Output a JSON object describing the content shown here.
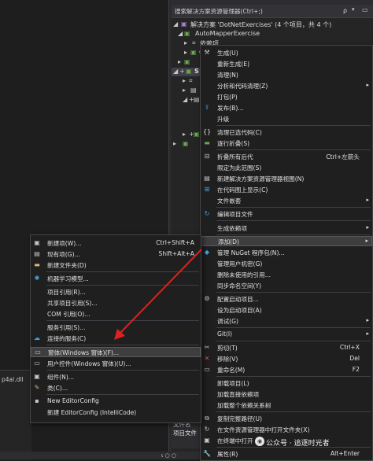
{
  "solution_explorer": {
    "search_placeholder": "搜索解决方案资源管理器(Ctrl+;)",
    "search_icon": "ρ",
    "tree": [
      {
        "text": "解决方案 'DotNetExercises' (4 个项目，共 4 个)"
      },
      {
        "text": "AutoMapperExercise"
      },
      {
        "text": "依赖项"
      },
      {
        "text": "C"
      },
      {
        "text": "S"
      }
    ]
  },
  "output": {
    "line": "p4al.dll"
  },
  "properties": {
    "file_name": "文件名",
    "project_file": "项目文件"
  },
  "status": {
    "zoom": "ι ○ ○"
  },
  "main_menu": {
    "items": [
      {
        "label": "生成(U)",
        "shortcut": "",
        "icon": "build-icon"
      },
      {
        "label": "重新生成(E)",
        "shortcut": ""
      },
      {
        "label": "清理(N)",
        "shortcut": ""
      },
      {
        "label": "分析和代码清理(Z)",
        "shortcut": "",
        "submenu": true
      },
      {
        "label": "打包(P)",
        "shortcut": ""
      },
      {
        "label": "发布(B)...",
        "shortcut": "",
        "icon": "publish-icon"
      },
      {
        "label": "升级",
        "shortcut": ""
      },
      {
        "label": "清理已选代码(C)",
        "shortcut": "",
        "icon": "braces-icon"
      },
      {
        "label": "逐行折叠(S)",
        "shortcut": ""
      },
      {
        "label": "折叠所有后代",
        "shortcut": "Ctrl+左箭头"
      },
      {
        "label": "限定为此范围(S)",
        "shortcut": ""
      },
      {
        "label": "新建解决方案资源管理器视图(N)",
        "shortcut": ""
      },
      {
        "label": "在代码图上显示(C)",
        "shortcut": ""
      },
      {
        "label": "文件嵌套",
        "shortcut": "",
        "submenu": true
      },
      {
        "label": "编辑项目文件",
        "shortcut": ""
      },
      {
        "label": "生成依赖项",
        "shortcut": "",
        "submenu": true
      },
      {
        "label": "添加(D)",
        "shortcut": "",
        "submenu": true
      },
      {
        "label": "管理 NuGet 程序包(N)...",
        "shortcut": ""
      },
      {
        "label": "管理用户机密(G)",
        "shortcut": ""
      },
      {
        "label": "删除未使用的引用...",
        "shortcut": ""
      },
      {
        "label": "同步命名空间(Y)",
        "shortcut": ""
      },
      {
        "label": "配置启动项目...",
        "shortcut": ""
      },
      {
        "label": "设为启动项目(A)",
        "shortcut": ""
      },
      {
        "label": "调试(G)",
        "shortcut": "",
        "submenu": true
      },
      {
        "label": "Git(I)",
        "shortcut": "",
        "submenu": true
      },
      {
        "label": "剪切(T)",
        "shortcut": "Ctrl+X"
      },
      {
        "label": "移除(V)",
        "shortcut": "Del"
      },
      {
        "label": "重命名(M)",
        "shortcut": "F2"
      },
      {
        "label": "卸载项目(L)",
        "shortcut": ""
      },
      {
        "label": "加载直接依赖项",
        "shortcut": ""
      },
      {
        "label": "加载整个依赖关系树",
        "shortcut": ""
      },
      {
        "label": "复制完整路径(U)",
        "shortcut": ""
      },
      {
        "label": "在文件资源管理器中打开文件夹(X)",
        "shortcut": ""
      },
      {
        "label": "在终端中打开",
        "shortcut": ""
      },
      {
        "label": "属性(R)",
        "shortcut": "Alt+Enter"
      }
    ]
  },
  "sub_menu": {
    "items": [
      {
        "label": "新建项(W)...",
        "shortcut": "Ctrl+Shift+A"
      },
      {
        "label": "现有项(G)...",
        "shortcut": "Shift+Alt+A"
      },
      {
        "label": "新建文件夹(D)",
        "shortcut": ""
      },
      {
        "label": "机器学习模型...",
        "shortcut": ""
      },
      {
        "label": "项目引用(R)...",
        "shortcut": ""
      },
      {
        "label": "共享项目引用(S)...",
        "shortcut": ""
      },
      {
        "label": "COM 引用(O)...",
        "shortcut": ""
      },
      {
        "label": "服务引用(S)...",
        "shortcut": ""
      },
      {
        "label": "连接的服务(C)",
        "shortcut": ""
      },
      {
        "label": "窗体(Windows 窗体)(F)...",
        "shortcut": ""
      },
      {
        "label": "用户控件(Windows 窗体)(U)...",
        "shortcut": ""
      },
      {
        "label": "组件(N)...",
        "shortcut": ""
      },
      {
        "label": "类(C)...",
        "shortcut": ""
      },
      {
        "label": "New EditorConfig",
        "shortcut": ""
      },
      {
        "label": "新建 EditorConfig (IntelliCode)",
        "shortcut": ""
      }
    ]
  },
  "watermark": {
    "text": "公众号 · 追逐时光者"
  },
  "colors": {
    "accent_arrow": "#e02020",
    "menu_bg": "#1f1f1f",
    "highlight": "#3e3e40"
  }
}
